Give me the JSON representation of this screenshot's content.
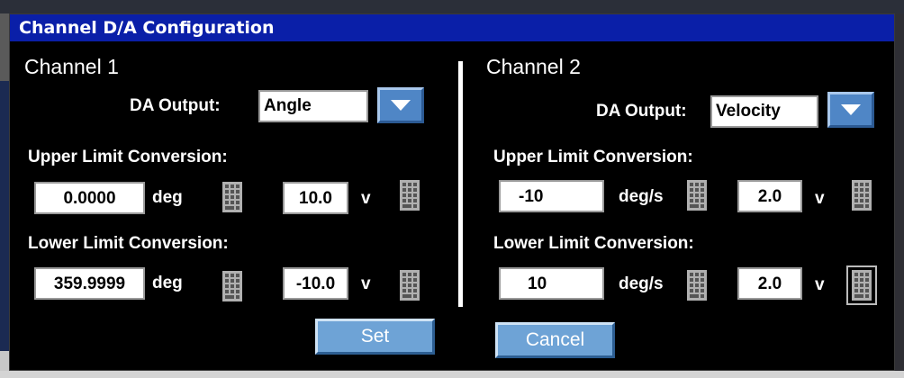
{
  "window": {
    "title": "Channel D/A Configuration"
  },
  "channel1": {
    "heading": "Channel 1",
    "da_output_label": "DA Output:",
    "da_output_value": "Angle",
    "upper_label": "Upper Limit Conversion:",
    "upper_value": "0.0000",
    "upper_unit": "deg",
    "upper_volt": "10.0",
    "upper_volt_unit": "v",
    "lower_label": "Lower Limit Conversion:",
    "lower_value": "359.9999",
    "lower_unit": "deg",
    "lower_volt": "-10.0",
    "lower_volt_unit": "v"
  },
  "channel2": {
    "heading": "Channel 2",
    "da_output_label": "DA Output:",
    "da_output_value": "Velocity",
    "upper_label": "Upper Limit Conversion:",
    "upper_value": "-10",
    "upper_unit": "deg/s",
    "upper_volt": "2.0",
    "upper_volt_unit": "v",
    "lower_label": "Lower Limit Conversion:",
    "lower_value": "10",
    "lower_unit": "deg/s",
    "lower_volt": "2.0",
    "lower_volt_unit": "v"
  },
  "buttons": {
    "set": "Set",
    "cancel": "Cancel"
  },
  "icons": {
    "dropdown": "chevron-down-icon",
    "keypad": "keypad-icon"
  },
  "colors": {
    "title_bar": "#0a1fa8",
    "button": "#6ea3d6",
    "background": "#000000"
  }
}
